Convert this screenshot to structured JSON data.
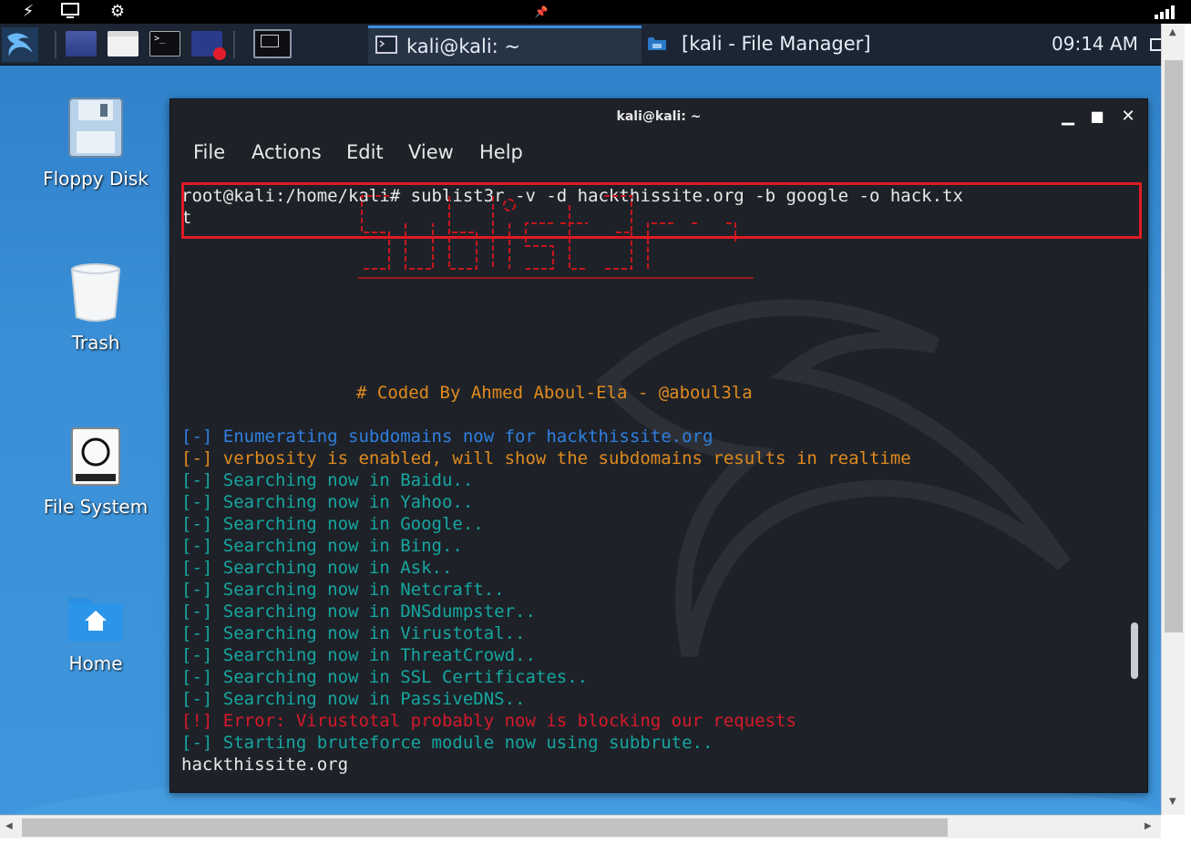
{
  "panel": {
    "tasks": [
      {
        "label": "kali@kali: ~",
        "active": true
      },
      {
        "label": "[kali - File Manager]",
        "active": false
      }
    ],
    "clock": "09:14 AM"
  },
  "desktop": {
    "icons": [
      {
        "label": "Floppy Disk",
        "icon": "floppy-disk-icon"
      },
      {
        "label": "Trash",
        "icon": "trash-icon"
      },
      {
        "label": "File System",
        "icon": "drive-icon"
      },
      {
        "label": "Home",
        "icon": "home-folder-icon"
      }
    ]
  },
  "terminal": {
    "title": "kali@kali: ~",
    "menu": [
      "File",
      "Actions",
      "Edit",
      "View",
      "Help"
    ],
    "command_line_1": "root@kali:/home/kali# sublist3r -v -d hackthissite.org -b google -o hack.tx",
    "command_line_2": "t",
    "banner_credit": "# Coded By Ahmed Aboul-Ela - @aboul3la",
    "output": [
      {
        "text": "[-] Enumerating subdomains now for hackthissite.org",
        "color": "#2f7fe0"
      },
      {
        "text": "[-] verbosity is enabled, will show the subdomains results in realtime",
        "color": "#e08a1e"
      },
      {
        "text": "[-] Searching now in Baidu..",
        "color": "#16a6a0"
      },
      {
        "text": "[-] Searching now in Yahoo..",
        "color": "#16a6a0"
      },
      {
        "text": "[-] Searching now in Google..",
        "color": "#16a6a0"
      },
      {
        "text": "[-] Searching now in Bing..",
        "color": "#16a6a0"
      },
      {
        "text": "[-] Searching now in Ask..",
        "color": "#16a6a0"
      },
      {
        "text": "[-] Searching now in Netcraft..",
        "color": "#16a6a0"
      },
      {
        "text": "[-] Searching now in DNSdumpster..",
        "color": "#16a6a0"
      },
      {
        "text": "[-] Searching now in Virustotal..",
        "color": "#16a6a0"
      },
      {
        "text": "[-] Searching now in ThreatCrowd..",
        "color": "#16a6a0"
      },
      {
        "text": "[-] Searching now in SSL Certificates..",
        "color": "#16a6a0"
      },
      {
        "text": "[-] Searching now in PassiveDNS..",
        "color": "#16a6a0"
      },
      {
        "text": "[!] Error: Virustotal probably now is blocking our requests",
        "color": "#d7192a"
      },
      {
        "text": "[-] Starting bruteforce module now using subbrute..",
        "color": "#16a6a0"
      },
      {
        "text": "hackthissite.org",
        "color": "#e8e8e8"
      }
    ]
  },
  "colors": {
    "highlight_box": "#e01b24",
    "ascii_banner": "#c4161c",
    "terminal_bg": "#1e2228"
  }
}
